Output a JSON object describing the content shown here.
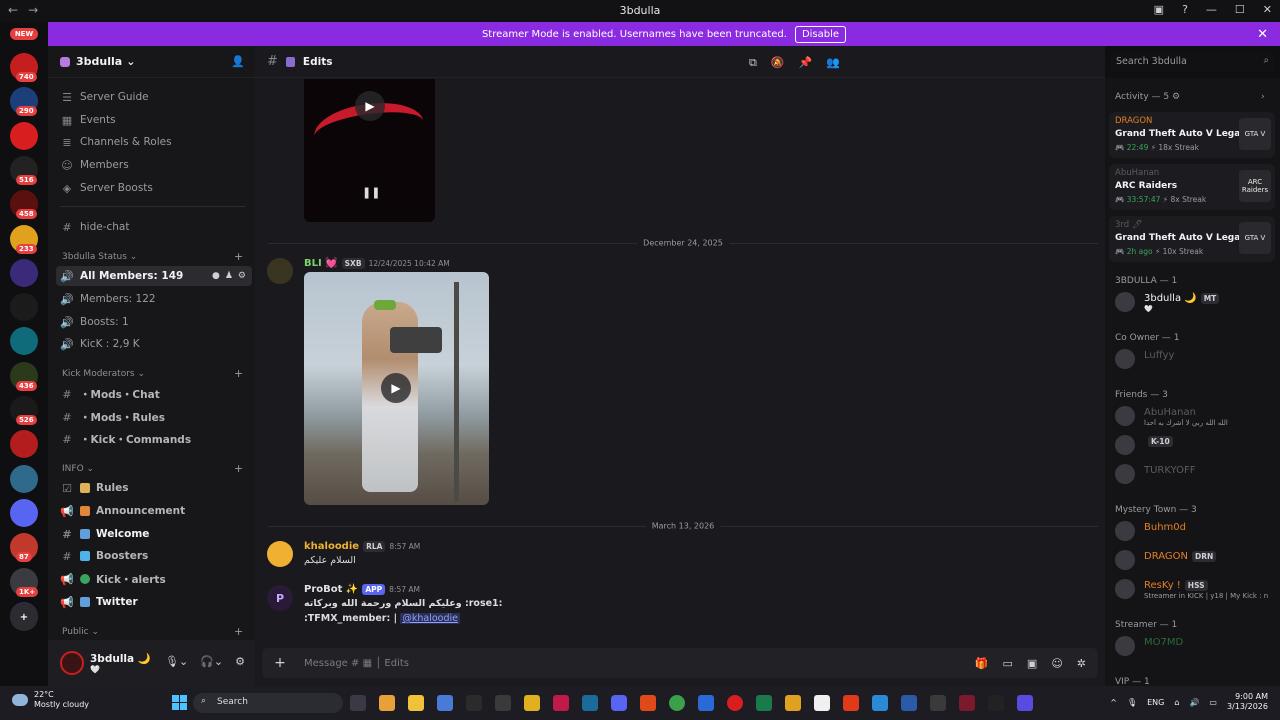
{
  "window": {
    "title": "3bdulla",
    "back": "←",
    "forward": "→"
  },
  "banner": {
    "text": "Streamer Mode is enabled. Usernames have been truncated.",
    "disable_label": "Disable"
  },
  "servers": {
    "new_badge": "NEW",
    "items": [
      {
        "badge": "740",
        "color": "#c41e1e"
      },
      {
        "badge": "290",
        "color": "#1c3f7a"
      },
      {
        "badge": "",
        "color": "#d81e1e"
      },
      {
        "badge": "516",
        "color": "#222"
      },
      {
        "badge": "458",
        "color": "#5b1010"
      },
      {
        "badge": "233",
        "color": "#e0a21c"
      },
      {
        "badge": "",
        "color": "#3b2a7a"
      },
      {
        "badge": "",
        "color": "#1b1b1b"
      },
      {
        "badge": "",
        "color": "#0f6a7a"
      },
      {
        "badge": "436",
        "color": "#2a3a1a"
      },
      {
        "badge": "526",
        "color": "#1a1a1a"
      },
      {
        "badge": "",
        "color": "#b31d1d"
      },
      {
        "badge": "",
        "color": "#2f6a8a"
      },
      {
        "badge": "",
        "color": "#5865f2"
      },
      {
        "badge": "87",
        "color": "#c0392b"
      },
      {
        "badge": "1K+",
        "color": "#3a3a40"
      },
      {
        "badge": "",
        "color": "#3b2a5a"
      }
    ]
  },
  "guild": {
    "name": "3bdulla"
  },
  "channels": {
    "top": [
      "Server Guide",
      "Events",
      "Channels & Roles",
      "Members",
      "Server Boosts"
    ],
    "hide_chat": "hide-chat",
    "status_cat": "3bdulla Status",
    "status": [
      "All Members: 149",
      "Members: 122",
      "Boosts: 1",
      "KicK : 2,9 K"
    ],
    "kick_cat": "Kick Moderators",
    "kick": [
      "・Mods・Chat",
      "・Mods・Rules",
      "・Kick・Commands"
    ],
    "info_cat": "INFO",
    "info": [
      "Rules",
      "Announcement",
      "Welcome",
      "Boosters",
      "Kick・alerts",
      "Twitter"
    ],
    "public_cat": "Public"
  },
  "user": {
    "name": "3bdulla 🌙",
    "status": "🤍"
  },
  "chat": {
    "channel": "Edits",
    "search_placeholder": "Search 3bdulla",
    "date1": "December 24, 2025",
    "msg1": {
      "name": "BLI 💓",
      "tag": "SXB",
      "time": "12/24/2025 10:42 AM"
    },
    "date2": "March 13, 2026",
    "msg2": {
      "name": "khaloodie",
      "tag": "RLA",
      "time": "8:57 AM",
      "text": "السلام عليكم"
    },
    "msg3": {
      "name": "ProBot ✨",
      "tag": "APP",
      "time": "8:57 AM",
      "line1": "وعليكم السلام ورحمة الله وبركاته :rose1:",
      "line2": ":TFMX_member: |",
      "mention": "@khaloodie"
    },
    "composer_placeholder": "Message #",
    "composer_channel": "Edits"
  },
  "members": {
    "activity": "Activity — 5",
    "activities": [
      {
        "user": "DRAGON",
        "user_color": "#e67e22",
        "game": "Grand Theft Auto V Legacy",
        "time": "22:49",
        "streak": "18x Streak",
        "art": "GTA V"
      },
      {
        "user": "AbuHanan",
        "user_color": "#5a5a62",
        "game": "ARC Raiders",
        "time": "33:57:47",
        "streak": "8x Streak",
        "art": "ARC Raiders"
      },
      {
        "user": "3rd 🖊",
        "user_color": "#5a5a62",
        "game": "Grand Theft Auto V Legacy",
        "time": "2h ago",
        "streak": "10x Streak",
        "art": "GTA V"
      }
    ],
    "groups": [
      {
        "label": "3BDULLA — 1",
        "members": [
          {
            "name": "3bdulla 🌙",
            "tag": "MT",
            "sub": "🤍",
            "color": "#f2f3f5"
          }
        ]
      },
      {
        "label": "Co Owner — 1",
        "members": [
          {
            "name": "Luffyy",
            "tag": "",
            "sub": "",
            "color": "#5a5a62"
          }
        ]
      },
      {
        "label": "Friends — 3",
        "members": [
          {
            "name": "AbuHanan",
            "tag": "",
            "sub": "الله الله ربي لا أشرك به أحدا",
            "color": "#5a5a62"
          },
          {
            "name": "",
            "tag": "K-10",
            "sub": "",
            "color": "#5a5a62"
          },
          {
            "name": "TURKYOFF",
            "tag": "",
            "sub": "",
            "color": "#5a5a62"
          }
        ]
      },
      {
        "label": "Mystery Town — 3",
        "members": [
          {
            "name": "Buhm0d",
            "tag": "",
            "sub": "",
            "color": "#e67e22"
          },
          {
            "name": "DRAGON",
            "tag": "DRN",
            "sub": "",
            "color": "#e67e22"
          },
          {
            "name": "ResKy !",
            "tag": "HSS",
            "sub": "Streamer in KICK | y18 | My Kick : n",
            "color": "#e67e22"
          }
        ]
      },
      {
        "label": "Streamer — 1",
        "members": [
          {
            "name": "MO7MD",
            "tag": "",
            "sub": "",
            "color": "#2d6a3a"
          }
        ]
      },
      {
        "label": "VIP — 1",
        "members": []
      }
    ]
  },
  "taskbar": {
    "temp": "22°C",
    "weather": "Mostly cloudy",
    "search": "Search",
    "lang": "ENG",
    "time": "9:00 AM",
    "date": "3/13/2026"
  }
}
